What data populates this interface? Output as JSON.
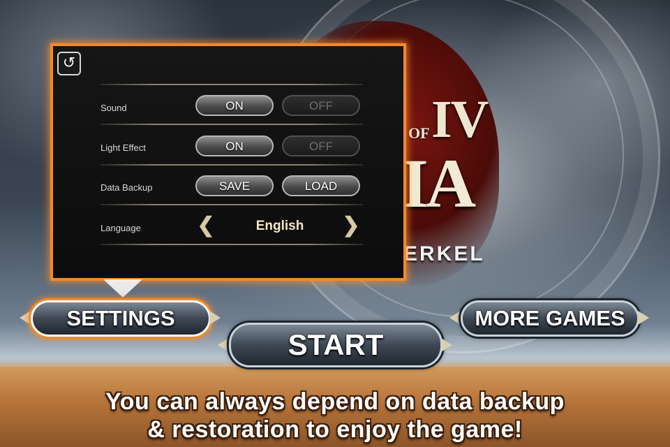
{
  "logo": {
    "roman": "IV",
    "of": "OF",
    "ia": "IA",
    "sub": "ERKEL"
  },
  "settings": {
    "back_icon": "undo-arrow-icon",
    "rows": [
      {
        "label": "Sound",
        "on": "ON",
        "off": "OFF",
        "selected": "ON"
      },
      {
        "label": "Light Effect",
        "on": "ON",
        "off": "OFF",
        "selected": "ON"
      },
      {
        "label": "Data Backup",
        "save": "SAVE",
        "load": "LOAD"
      },
      {
        "label": "Language",
        "value": "English",
        "prev_icon": "chevron-left-icon",
        "next_icon": "chevron-right-icon"
      }
    ]
  },
  "menu": {
    "settings": "SETTINGS",
    "start": "START",
    "more_games": "MORE GAMES"
  },
  "caption": {
    "line1": "You can always depend on data backup",
    "line2": "& restoration to enjoy the game!"
  },
  "colors": {
    "accent": "#f08a2a",
    "panel_bg": "#111111",
    "language_text": "#f3e7c6"
  }
}
